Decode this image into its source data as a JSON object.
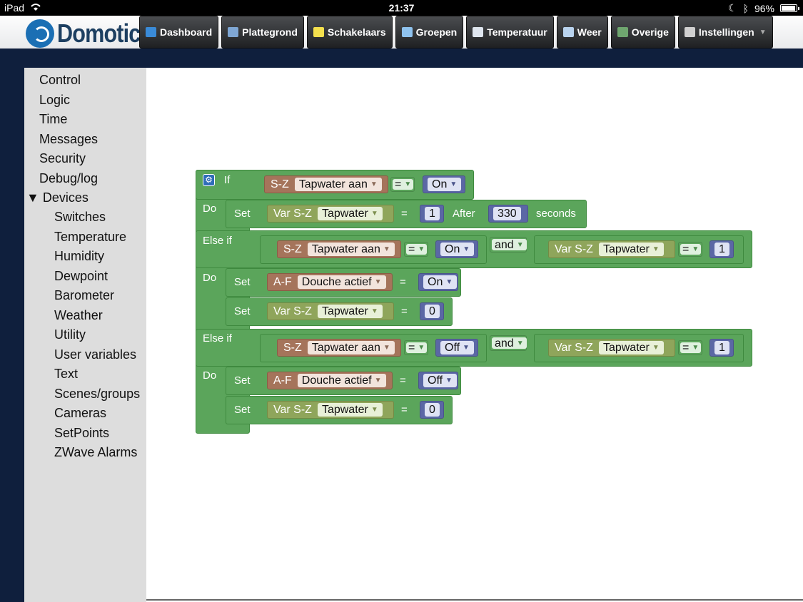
{
  "status": {
    "device": "iPad",
    "time": "21:37",
    "battery": "96%",
    "battery_level": 0.96
  },
  "app": {
    "logo_text": "Domoticz"
  },
  "nav": [
    {
      "label": "Dashboard",
      "icon": "dashboard-icon",
      "color": "#3a8bd8"
    },
    {
      "label": "Plattegrond",
      "icon": "house-icon",
      "color": "#7fa7d4"
    },
    {
      "label": "Schakelaars",
      "icon": "lightbulb-icon",
      "color": "#f4e04d"
    },
    {
      "label": "Groepen",
      "icon": "scene-icon",
      "color": "#8fc3ef"
    },
    {
      "label": "Temperatuur",
      "icon": "thermometer-icon",
      "color": "#dfe6ef"
    },
    {
      "label": "Weer",
      "icon": "weather-icon",
      "color": "#b9d3ee"
    },
    {
      "label": "Overige",
      "icon": "globe-icon",
      "color": "#6fa66f"
    },
    {
      "label": "Instellingen",
      "icon": "tools-icon",
      "color": "#d0d0d0"
    }
  ],
  "toolbox": {
    "items": [
      "Control",
      "Logic",
      "Time",
      "Messages",
      "Security",
      "Debug/log"
    ],
    "devices_label": "Devices",
    "devices": [
      "Switches",
      "Temperature",
      "Humidity",
      "Dewpoint",
      "Barometer",
      "Weather",
      "Utility",
      "User variables",
      "Text",
      "Scenes/groups",
      "Cameras",
      "SetPoints",
      "ZWave Alarms"
    ]
  },
  "blockly": {
    "if": "If",
    "do": "Do",
    "else_if": "Else if",
    "set": "Set",
    "and": "and",
    "eq": "=",
    "after": "After",
    "seconds": "seconds",
    "sz": "S-Z",
    "var_sz": "Var S-Z",
    "af": "A-F",
    "tapwater_aan": "Tapwater aan",
    "tapwater": "Tapwater",
    "douche_actief": "Douche actief",
    "on": "On",
    "off": "Off",
    "one": "1",
    "zero": "0",
    "delay": "330"
  }
}
